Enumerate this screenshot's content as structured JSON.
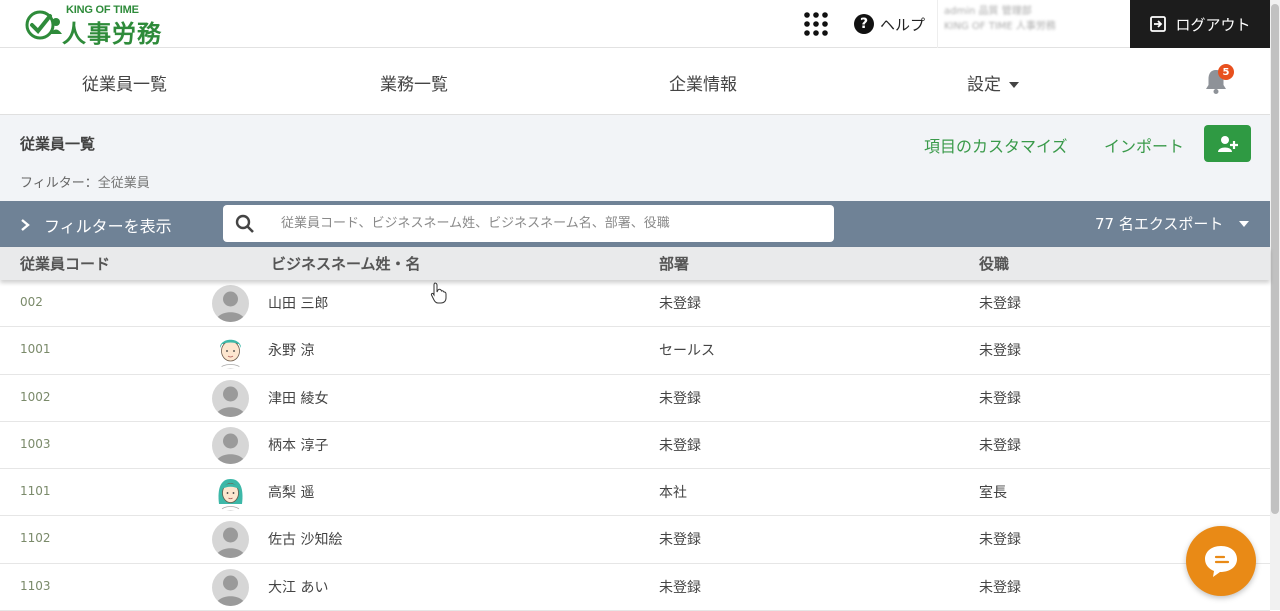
{
  "header": {
    "logo_top": "KING OF TIME",
    "logo_main": "人事労務",
    "help_label": "ヘルプ",
    "user_line1": "admin 品質 管理部",
    "user_line2": "KING OF TIME 人事労務",
    "logout_label": "ログアウト"
  },
  "nav": {
    "items": [
      "従業員一覧",
      "業務一覧",
      "企業情報",
      "設定"
    ],
    "notification_count": "5"
  },
  "subheader": {
    "title": "従業員一覧",
    "filter_key": "フィルター：",
    "filter_value": "全従業員",
    "customize_label": "項目のカスタマイズ",
    "import_label": "インポート"
  },
  "filterbar": {
    "show_filter_label": "フィルターを表示",
    "search_placeholder": "従業員コード、ビジネスネーム姓、ビジネスネーム名、部署、役職",
    "export_label": "77 名エクスポート"
  },
  "table": {
    "columns": [
      "従業員コード",
      "ビジネスネーム姓・名",
      "部署",
      "役職"
    ],
    "rows": [
      {
        "code": "002",
        "name": "山田 三郎",
        "dept": "未登録",
        "pos": "未登録",
        "avatar": "default"
      },
      {
        "code": "1001",
        "name": "永野 涼",
        "dept": "セールス",
        "pos": "未登録",
        "avatar": "male-illustration"
      },
      {
        "code": "1002",
        "name": "津田 綾女",
        "dept": "未登録",
        "pos": "未登録",
        "avatar": "default"
      },
      {
        "code": "1003",
        "name": "柄本 淳子",
        "dept": "未登録",
        "pos": "未登録",
        "avatar": "default"
      },
      {
        "code": "1101",
        "name": "高梨 遥",
        "dept": "本社",
        "pos": "室長",
        "avatar": "female-illustration"
      },
      {
        "code": "1102",
        "name": "佐古 沙知絵",
        "dept": "未登録",
        "pos": "未登録",
        "avatar": "default"
      },
      {
        "code": "1103",
        "name": "大江 あい",
        "dept": "未登録",
        "pos": "未登録",
        "avatar": "default"
      }
    ]
  },
  "colors": {
    "brand_green": "#2e8b3a",
    "filterbar": "#6f8296",
    "chat_orange": "#e98a16",
    "badge": "#e8501e"
  }
}
